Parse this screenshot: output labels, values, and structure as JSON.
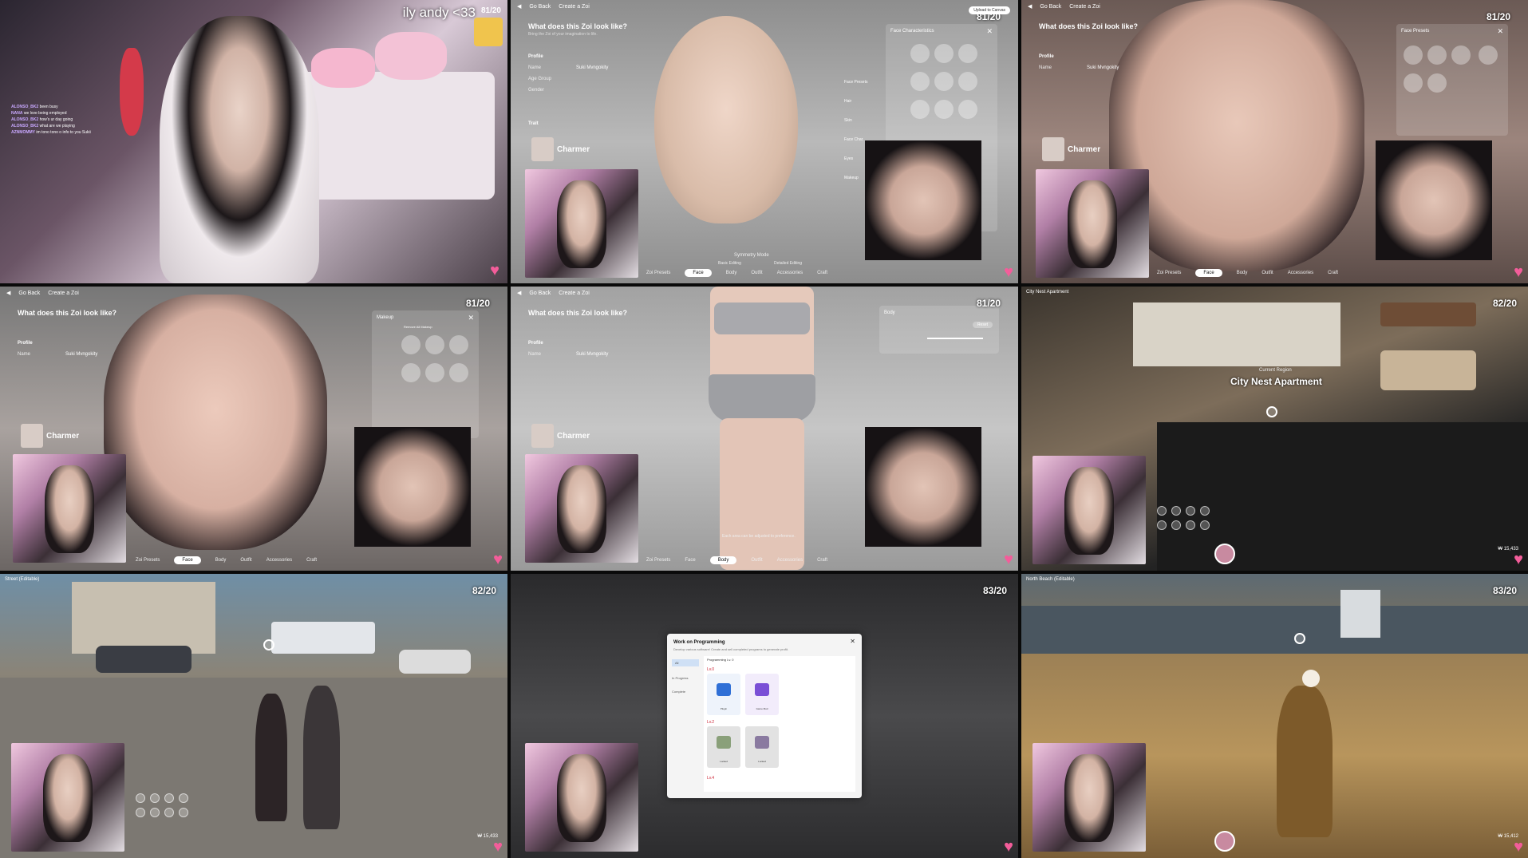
{
  "panel1": {
    "stream_title": "ily andy <33",
    "counter": "81/20",
    "chat": [
      {
        "user": "ALONSO_BK2",
        "msg": "been busy"
      },
      {
        "user": "NANA",
        "msg": "we love being employed"
      },
      {
        "user": "ALONSO_BK2",
        "msg": "how's ur day going"
      },
      {
        "user": "ALONSO_BK2",
        "msg": "what are we playing"
      },
      {
        "user": "AZNMOMMY",
        "msg": "im tono tono o info to you Sukii"
      }
    ]
  },
  "creator": {
    "go_back": "Go Back",
    "create": "Create a Zoi",
    "upload": "Upload to Canvas",
    "question": "What does this Zoi look like?",
    "question_sub": "Bring the Zoi of your imagination to life.",
    "profile_label": "Profile",
    "name_label": "Name",
    "name_value": "Suki Mvngokity",
    "age_label": "Age Group",
    "gender_label": "Gender",
    "trait_label": "Trait",
    "trait_sub": "Kind and Generous",
    "trait_name": "Charmer",
    "tabs": [
      "Zoi Presets",
      "Face",
      "Body",
      "Outfit",
      "Accessories",
      "Craft"
    ],
    "symmetry": "Symmetry Mode",
    "basic_editing": "Basic Editing",
    "detailed_editing": "Detailed Editing",
    "side_list": [
      "Face Presets",
      "Hair",
      "Skin",
      "Face Char.",
      "Eyes",
      "Makeup"
    ]
  },
  "panel2": {
    "counter": "81/20",
    "side_title": "Face Characteristics"
  },
  "panel3": {
    "counter": "81/20",
    "side_title": "Face Presets"
  },
  "panel4": {
    "counter": "81/20",
    "side_title": "Makeup",
    "side_sub": "Remove All Makeup"
  },
  "panel5": {
    "counter": "81/20",
    "side_title": "Body",
    "reset": "Reset",
    "body_note": "Each area can be adjusted to preference."
  },
  "panel6": {
    "counter": "82/20",
    "loc": "City Nest Apartment",
    "place_title": "City Nest Apartment",
    "place_sub": "Current Region",
    "money": "₩ 15,433"
  },
  "panel7": {
    "counter": "82/20",
    "loc": "Street (Editable)",
    "money": "₩ 15,433"
  },
  "panel8": {
    "counter": "83/20",
    "dialog_title": "Work on Programming",
    "dialog_sub": "Develop various software! Create and sell completed programs to generate profit.",
    "tabs": [
      "All",
      "In Progress",
      "Complete"
    ],
    "head": "Programming Lv. 0",
    "sections": [
      "Lv.0",
      "Lv.2",
      "Lv.4"
    ],
    "cards": [
      "Plugin",
      "Game Mod",
      "Locked",
      "Locked"
    ]
  },
  "panel9": {
    "counter": "83/20",
    "loc": "North Beach (Editable)",
    "money": "₩ 15,412"
  }
}
